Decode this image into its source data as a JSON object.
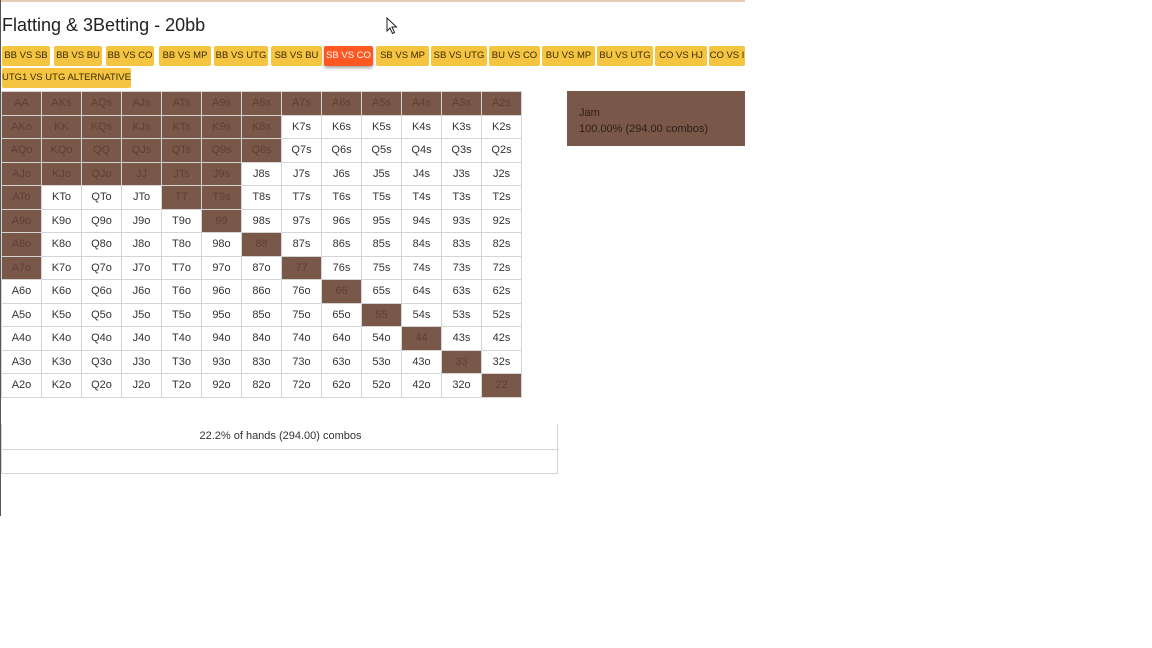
{
  "page": {
    "title": "Flatting & 3Betting - 20bb"
  },
  "tabs": [
    {
      "label": "BB VS SB",
      "active": false
    },
    {
      "label": "BB VS BU",
      "active": false
    },
    {
      "label": "BB VS CO",
      "active": false
    },
    {
      "label": "BB VS MP",
      "active": false
    },
    {
      "label": "BB VS UTG",
      "active": false
    },
    {
      "label": "SB VS BU",
      "active": false
    },
    {
      "label": "SB VS CO",
      "active": true
    },
    {
      "label": "SB VS MP",
      "active": false
    },
    {
      "label": "SB VS UTG",
      "active": false
    },
    {
      "label": "BU VS CO",
      "active": false
    },
    {
      "label": "BU VS MP",
      "active": false
    },
    {
      "label": "BU VS UTG",
      "active": false
    },
    {
      "label": "CO VS HJ",
      "active": false
    },
    {
      "label": "CO VS I",
      "active": false
    },
    {
      "label": "UTG1 VS UTG ALTERNATIVE",
      "active": false
    }
  ],
  "grid": {
    "ranks": [
      "A",
      "K",
      "Q",
      "J",
      "T",
      "9",
      "8",
      "7",
      "6",
      "5",
      "4",
      "3",
      "2"
    ],
    "jam_hands": [
      "AA",
      "AKs",
      "AQs",
      "AJs",
      "ATs",
      "A9s",
      "A8s",
      "A7s",
      "A6s",
      "A5s",
      "A4s",
      "A3s",
      "A2s",
      "AKo",
      "KK",
      "KQs",
      "KJs",
      "KTs",
      "K9s",
      "K8s",
      "AQo",
      "KQo",
      "QQ",
      "QJs",
      "QTs",
      "Q9s",
      "Q8s",
      "AJo",
      "KJo",
      "QJo",
      "JJ",
      "JTs",
      "J9s",
      "ATo",
      "TT",
      "T9s",
      "A9o",
      "99",
      "A8o",
      "88",
      "A7o",
      "77",
      "66",
      "55",
      "44",
      "33",
      "22"
    ]
  },
  "summary": {
    "text": "22.2% of hands (294.00) combos"
  },
  "legend": {
    "action": "Jam",
    "detail": "100.00% (294.00 combos)",
    "color": "#7a5849"
  }
}
